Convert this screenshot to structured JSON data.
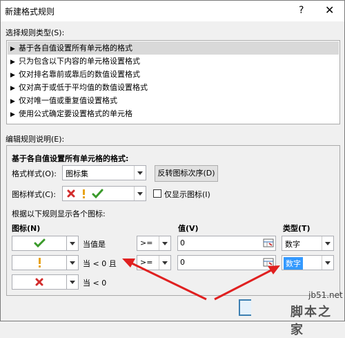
{
  "dialog": {
    "title": "新建格式规则",
    "help": "?",
    "close": "✕"
  },
  "rule_type_section": {
    "label": "选择规则类型(S):",
    "items": [
      "基于各自值设置所有单元格的格式",
      "只为包含以下内容的单元格设置格式",
      "仅对排名靠前或靠后的数值设置格式",
      "仅对高于或低于平均值的数值设置格式",
      "仅对唯一值或重复值设置格式",
      "使用公式确定要设置格式的单元格"
    ],
    "selected_index": 0
  },
  "rule_desc_section": {
    "label": "编辑规则说明(E):",
    "heading": "基于各自值设置所有单元格的格式:",
    "format_style_label": "格式样式(O):",
    "format_style_value": "图标集",
    "reverse_button": "反转图标次序(D)",
    "icon_style_label": "图标样式(C):",
    "show_icon_only_label": "仅显示图标(I)",
    "show_icon_only_checked": false,
    "rules_caption": "根据以下规则显示各个图标:",
    "col_icon": "图标(N)",
    "col_value": "值(V)",
    "col_type": "类型(T)",
    "rows": [
      {
        "icon": "green-check",
        "condition": "当值是",
        "operator": ">=",
        "value": "0",
        "type": "数字"
      },
      {
        "icon": "yellow-exclamation",
        "condition": "当 < 0 且",
        "operator": ">=",
        "value": "0",
        "type": "数字"
      },
      {
        "icon": "red-cross",
        "condition": "当 < 0"
      }
    ]
  },
  "watermark": {
    "line1": "jb51.net",
    "line2": "脚本之家"
  },
  "colors": {
    "check": "#3a9a2a",
    "exclaim": "#e8a317",
    "cross": "#d22c2c",
    "arrow": "#e02020",
    "selected_type_bg": "#3399ff"
  }
}
